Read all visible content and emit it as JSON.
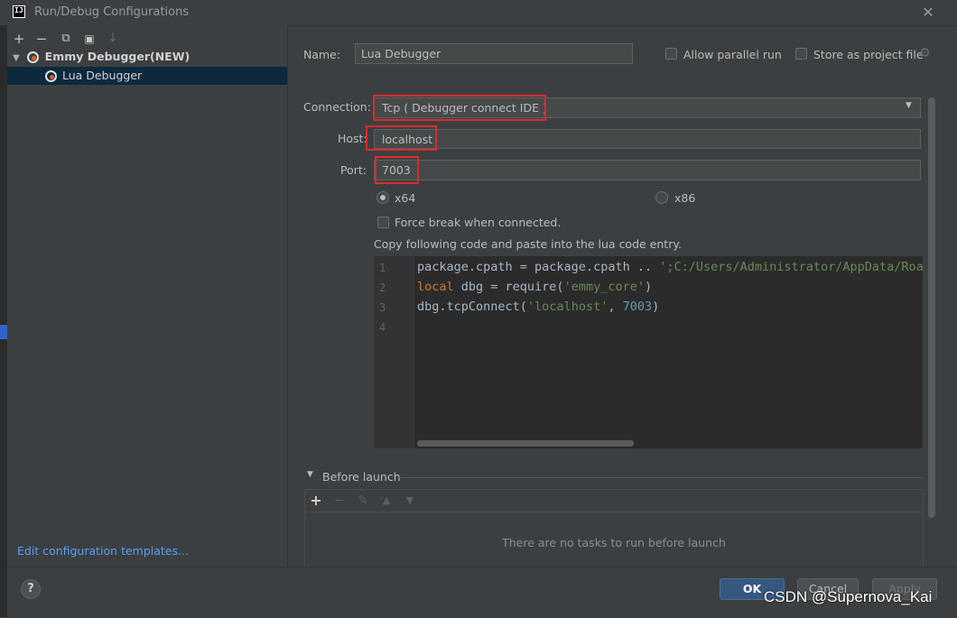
{
  "window": {
    "title": "Run/Debug Configurations",
    "app_icon_text": "IJ"
  },
  "left_toolbar": {
    "add": "+",
    "remove": "−",
    "copy": "⧉",
    "folder": "▣",
    "sort": "↓"
  },
  "tree": {
    "group_label": "Emmy Debugger(NEW)",
    "item_label": "Lua Debugger"
  },
  "edit_templates_link": "Edit configuration templates...",
  "form": {
    "name_label": "Name:",
    "name_value": "Lua Debugger",
    "allow_parallel_label": "Allow parallel run",
    "store_project_label": "Store as project file",
    "connection_label": "Connection:",
    "connection_value": "Tcp ( Debugger connect IDE )",
    "host_label": "Host:",
    "host_value": "localhost",
    "port_label": "Port:",
    "port_value": "7003",
    "arch_options": [
      {
        "label": "x64",
        "selected": true
      },
      {
        "label": "x86",
        "selected": false
      }
    ],
    "force_break_label": "Force break when connected.",
    "copy_hint": "Copy following code and paste into the lua code entry."
  },
  "code": {
    "line_numbers": [
      "1",
      "2",
      "3",
      "4"
    ],
    "line1": {
      "a": "package.cpath = package.cpath .. ",
      "b": "';C:/Users/Administrator/AppData/Roam"
    },
    "line2": {
      "kw": "local",
      "a": " dbg = require(",
      "str": "'emmy_core'",
      "b": ")"
    },
    "line3": {
      "a": "dbg.tcpConnect(",
      "str": "'localhost'",
      "sep": ", ",
      "num": "7003",
      "b": ")"
    }
  },
  "before_launch": {
    "title": "Before launch",
    "empty_text": "There are no tasks to run before launch"
  },
  "buttons": {
    "help": "?",
    "ok": "OK",
    "cancel": "Cancel",
    "apply": "Apply"
  },
  "watermark": "CSDN @Supernova_Kai",
  "colors": {
    "accent": "#365880",
    "highlight": "#e0282e",
    "link": "#589df6",
    "selection": "#0d293e"
  }
}
